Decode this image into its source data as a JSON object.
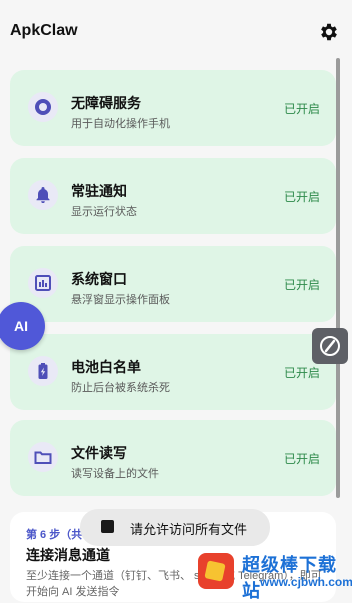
{
  "header": {
    "app_title": "ApkClaw",
    "settings_icon": "gear-icon"
  },
  "permissions": [
    {
      "title": "无障碍服务",
      "subtitle": "用于自动化操作手机",
      "status": "已开启",
      "icon": "accessibility-icon"
    },
    {
      "title": "常驻通知",
      "subtitle": "显示运行状态",
      "status": "已开启",
      "icon": "bell-icon"
    },
    {
      "title": "系统窗口",
      "subtitle": "悬浮窗显示操作面板",
      "status": "已开启",
      "icon": "window-icon"
    },
    {
      "title": "电池白名单",
      "subtitle": "防止后台被系统杀死",
      "status": "已开启",
      "icon": "battery-icon"
    },
    {
      "title": "文件读写",
      "subtitle": "读写设备上的文件",
      "status": "已开启",
      "icon": "folder-icon"
    }
  ],
  "channel": {
    "step": "第 6 步（共",
    "title": "连接消息通道",
    "description": "至少连接一个通道（钉钉、飞书、 scord 或 Telegram），即可开始向 AI 发送指令"
  },
  "toast": {
    "text": "请允许访问所有文件"
  },
  "floating": {
    "ai_label": "AI"
  },
  "watermark": {
    "title": "超级棒下载站",
    "url": "www.cjbwh.com"
  },
  "colors": {
    "card_bg": "#dff5e6",
    "status_green": "#2e8a4b",
    "accent_purple": "#5058d8"
  }
}
